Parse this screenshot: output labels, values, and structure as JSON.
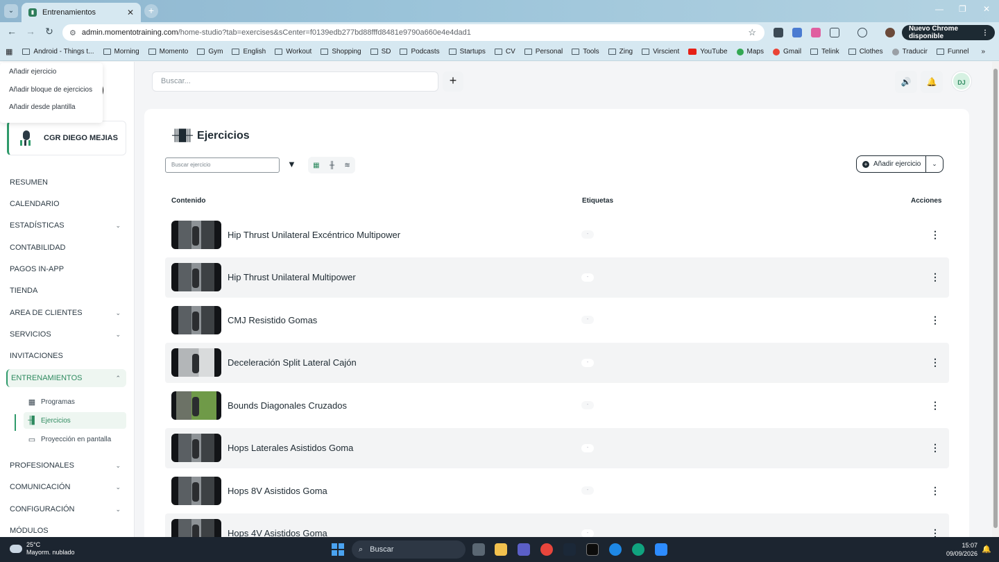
{
  "browser": {
    "tab_title": "Entrenamientos",
    "tab_close": "✕",
    "url_host": "admin.momentotraining.com",
    "url_path": "/home-studio?tab=exercises&sCenter=f0139edb277bd88fffd8481e9790a660e4e4dad1",
    "update_label": "Nuevo Chrome disponible",
    "bookmarks": [
      "Android - Things t...",
      "Morning",
      "Momento",
      "Gym",
      "English",
      "Workout",
      "Shopping",
      "SD",
      "Podcasts",
      "Startups",
      "CV",
      "Personal",
      "Tools",
      "Zing",
      "Virscient",
      "YouTube",
      "Maps",
      "Gmail",
      "Telink",
      "Clothes",
      "Traducir",
      "Funnel"
    ]
  },
  "dropdown": {
    "items": [
      "Añadir ejercicio",
      "Añadir bloque de ejercicios",
      "Añadir desde plantilla"
    ]
  },
  "sidebar": {
    "studio_name": "CGR DIEGO MEJIAS",
    "items": [
      "RESUMEN",
      "CALENDARIO",
      "ESTADÍSTICAS",
      "CONTABILIDAD",
      "PAGOS IN-APP",
      "TIENDA",
      "AREA DE CLIENTES",
      "SERVICIOS",
      "INVITACIONES",
      "ENTRENAMIENTOS",
      "PROFESIONALES",
      "COMUNICACIÓN",
      "CONFIGURACIÓN",
      "MÓDULOS"
    ],
    "subitems": [
      "Programas",
      "Ejercicios",
      "Proyección en pantalla"
    ]
  },
  "header": {
    "search_placeholder": "Buscar...",
    "avatar_initials": "DJ"
  },
  "content": {
    "title": "Ejercicios",
    "search_placeholder": "Buscar ejercicio",
    "add_button": "Añadir ejercicio",
    "columns": [
      "Contenido",
      "Etiquetas",
      "Acciones"
    ],
    "tag_placeholder": "-",
    "exercises": [
      "Hip Thrust Unilateral Excéntrico Multipower",
      "Hip Thrust Unilateral Multipower",
      "CMJ Resistido Gomas",
      "Deceleración Split Lateral Cajón",
      "Bounds Diagonales Cruzados",
      "Hops Laterales Asistidos Goma",
      "Hops 8V Asistidos Goma",
      "Hops 4V Asistidos Goma"
    ]
  },
  "taskbar": {
    "temperature": "25°C",
    "weather": "Mayorm. nublado",
    "search_label": "Buscar",
    "time": "15:07",
    "date": "09/09/2026"
  },
  "colors": {
    "accent": "#2e9a6a",
    "active_bg": "#eef6f1",
    "dark": "#1e2a32"
  }
}
